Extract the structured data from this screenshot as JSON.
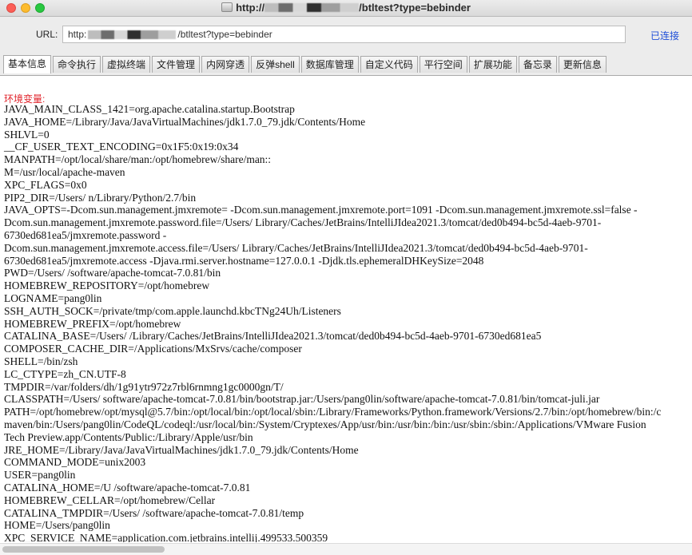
{
  "window": {
    "title": "http://   /btltest?type=bebinder",
    "title_prefix": "http://",
    "title_suffix": "/btltest?type=bebinder"
  },
  "url_bar": {
    "label": "URL:",
    "value_prefix": "http:",
    "value_suffix": "/btltest?type=bebinder",
    "status": "已连接"
  },
  "tabs": [
    {
      "label": "基本信息",
      "active": true
    },
    {
      "label": "命令执行"
    },
    {
      "label": "虚拟终端"
    },
    {
      "label": "文件管理"
    },
    {
      "label": "内网穿透"
    },
    {
      "label": "反弹shell"
    },
    {
      "label": "数据库管理"
    },
    {
      "label": "自定义代码"
    },
    {
      "label": "平行空间"
    },
    {
      "label": "扩展功能"
    },
    {
      "label": "备忘录"
    },
    {
      "label": "更新信息"
    }
  ],
  "content": {
    "env_title": "环境变量:",
    "env_lines": [
      "JAVA_MAIN_CLASS_1421=org.apache.catalina.startup.Bootstrap",
      "JAVA_HOME=/Library/Java/JavaVirtualMachines/jdk1.7.0_79.jdk/Contents/Home",
      "SHLVL=0",
      "__CF_USER_TEXT_ENCODING=0x1F5:0x19:0x34",
      "MANPATH=/opt/local/share/man:/opt/homebrew/share/man::",
      "M=/usr/local/apache-maven",
      "XPC_FLAGS=0x0",
      "PIP2_DIR=/Users/    n/Library/Python/2.7/bin",
      "JAVA_OPTS=-Dcom.sun.management.jmxremote= -Dcom.sun.management.jmxremote.port=1091 -Dcom.sun.management.jmxremote.ssl=false -",
      "Dcom.sun.management.jmxremote.password.file=/Users/      Library/Caches/JetBrains/IntelliJIdea2021.3/tomcat/ded0b494-bc5d-4aeb-9701-",
      "6730ed681ea5/jmxremote.password -",
      "Dcom.sun.management.jmxremote.access.file=/Users/      Library/Caches/JetBrains/IntelliJIdea2021.3/tomcat/ded0b494-bc5d-4aeb-9701-",
      "6730ed681ea5/jmxremote.access -Djava.rmi.server.hostname=127.0.0.1 -Djdk.tls.ephemeralDHKeySize=2048",
      "PWD=/Users/     /software/apache-tomcat-7.0.81/bin",
      "HOMEBREW_REPOSITORY=/opt/homebrew",
      "LOGNAME=pang0lin",
      "SSH_AUTH_SOCK=/private/tmp/com.apple.launchd.kbcTNg24Uh/Listeners",
      "HOMEBREW_PREFIX=/opt/homebrew",
      "CATALINA_BASE=/Users/      /Library/Caches/JetBrains/IntelliJIdea2021.3/tomcat/ded0b494-bc5d-4aeb-9701-6730ed681ea5",
      "COMPOSER_CACHE_DIR=/Applications/MxSrvs/cache/composer",
      "SHELL=/bin/zsh",
      "LC_CTYPE=zh_CN.UTF-8",
      "TMPDIR=/var/folders/dh/1g91ytr972z7rbl6rnmng1gc0000gn/T/",
      "CLASSPATH=/Users/      software/apache-tomcat-7.0.81/bin/bootstrap.jar:/Users/pang0lin/software/apache-tomcat-7.0.81/bin/tomcat-juli.jar",
      "PATH=/opt/homebrew/opt/mysql@5.7/bin:/opt/local/bin:/opt/local/sbin:/Library/Frameworks/Python.framework/Versions/2.7/bin:/opt/homebrew/bin:/c",
      "maven/bin:/Users/pang0lin/CodeQL/codeql:/usr/local/bin:/System/Cryptexes/App/usr/bin:/usr/bin:/bin:/usr/sbin:/sbin:/Applications/VMware Fusion",
      "Tech Preview.app/Contents/Public:/Library/Apple/usr/bin",
      "JRE_HOME=/Library/Java/JavaVirtualMachines/jdk1.7.0_79.jdk/Contents/Home",
      "COMMAND_MODE=unix2003",
      "USER=pang0lin",
      "CATALINA_HOME=/U      /software/apache-tomcat-7.0.81",
      "HOMEBREW_CELLAR=/opt/homebrew/Cellar",
      "CATALINA_TMPDIR=/Users/      /software/apache-tomcat-7.0.81/temp",
      "HOME=/Users/pang0lin",
      "XPC_SERVICE_NAME=application.com.jetbrains.intellij.499533.500359"
    ]
  },
  "icons": {
    "window_close": "close-icon",
    "window_minimize": "minimize-icon",
    "window_zoom": "zoom-icon",
    "title_doc": "document-icon"
  },
  "colors": {
    "env_title": "#e1232b",
    "status_link": "#1f4fd8",
    "close": "#fc5f57",
    "minimize": "#fdbc2e",
    "zoom": "#28c840"
  }
}
